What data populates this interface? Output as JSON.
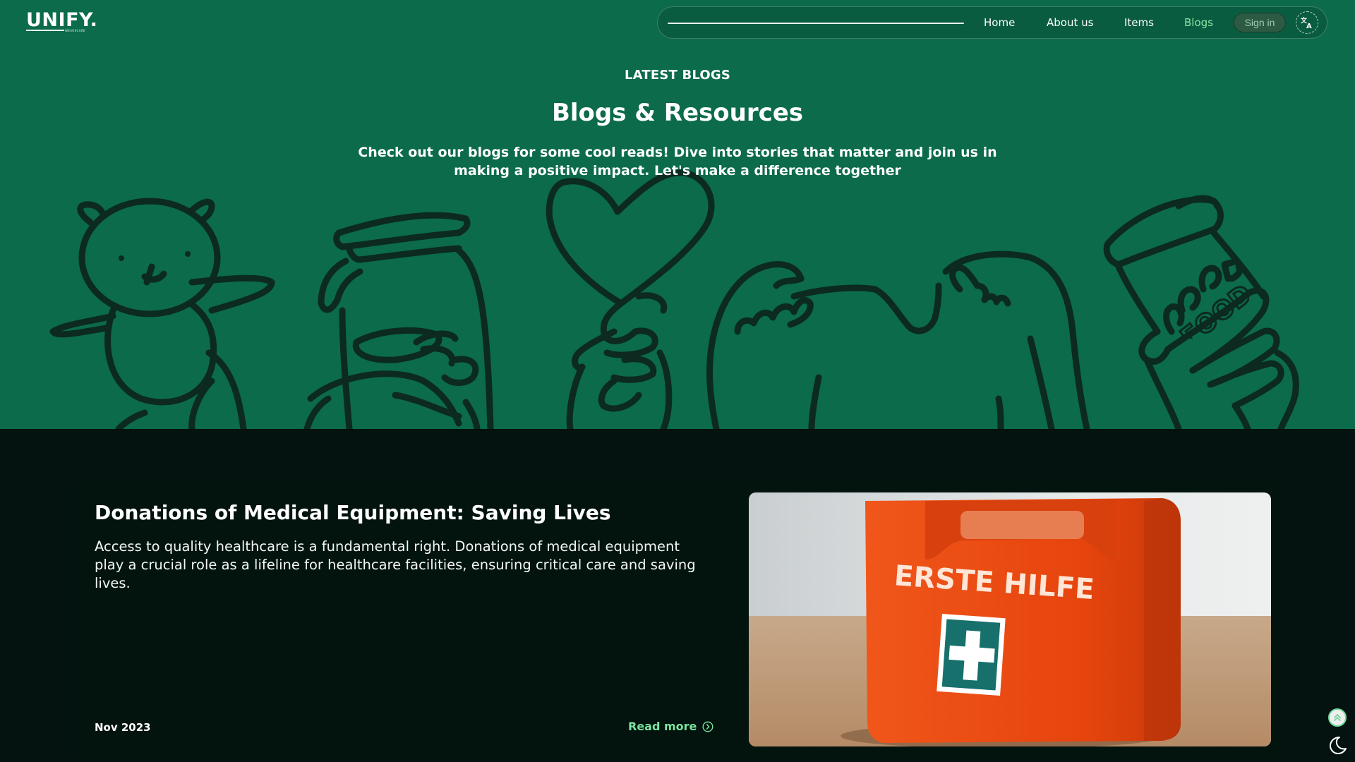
{
  "brand": {
    "name": "UNIFY.",
    "tagline": "WEARECARE"
  },
  "nav": {
    "items": [
      {
        "label": "Home"
      },
      {
        "label": "About us"
      },
      {
        "label": "Items"
      },
      {
        "label": "Blogs",
        "active": true
      }
    ],
    "signin_label": "Sign in",
    "language_icon": "translate-icon"
  },
  "hero": {
    "eyebrow": "LATEST BLOGS",
    "title": "Blogs & Resources",
    "description": "Check out our blogs for some cool reads! Dive into stories that matter and join us in making a positive impact. Let's make a difference together",
    "illustration_words": [
      "FOOD"
    ]
  },
  "blog_card": {
    "title": "Donations of Medical Equipment: Saving Lives",
    "body": "Access to quality healthcare is a fundamental right. Donations of medical equipment play a crucial role as a lifeline for healthcare facilities, ensuring critical care and saving lives.",
    "date": "Nov 2023",
    "read_more_label": "Read more",
    "image_text": "ERSTE HILFE"
  },
  "floating": {
    "scroll_top_icon": "chevrons-up-icon",
    "theme_icon": "moon-icon"
  },
  "colors": {
    "hero_bg": "#0b6b4a",
    "page_bg": "#041210",
    "accent": "#7be39d",
    "doodle_stroke": "#0c2a1f",
    "kit_orange": "#ee4f14"
  }
}
